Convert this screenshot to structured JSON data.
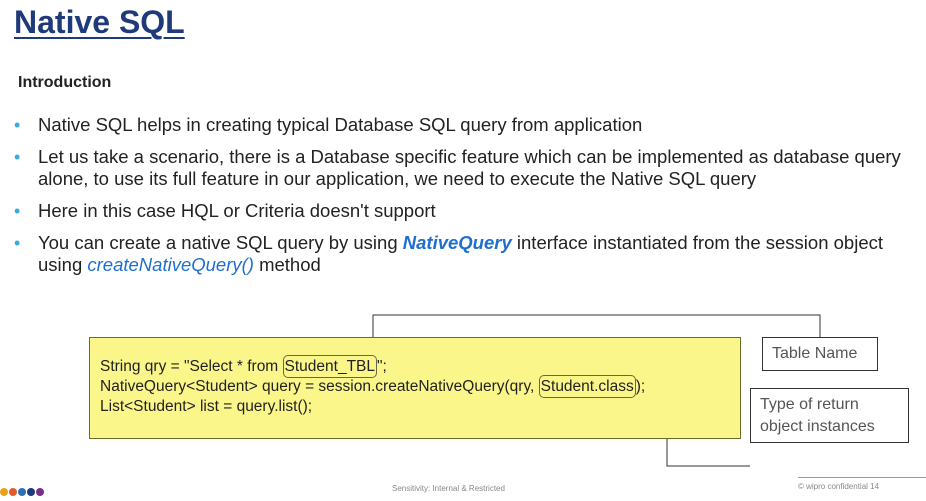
{
  "title": "Native SQL",
  "subtitle": "Introduction",
  "bullets": {
    "b1": "Native SQL helps in creating typical Database SQL query from application",
    "b2": "Let us take a scenario, there is a Database specific feature which can be implemented as database query alone, to use its full feature in our application, we need to execute the Native SQL query",
    "b3": "Here in this case HQL or Criteria doesn't support",
    "b4_pre": "You can create a native SQL query by using ",
    "b4_emph1": "NativeQuery",
    "b4_mid": " interface instantiated from the session object using ",
    "b4_emph2": "createNativeQuery()",
    "b4_post": " method"
  },
  "bullet_glyph": "•",
  "code": {
    "l1_pre": "String qry = \"Select * from ",
    "l1_hl": "Student_TBL",
    "l1_post": "\";",
    "l2_pre": "NativeQuery<Student> query = session.createNativeQuery(qry, ",
    "l2_hl": "Student.class",
    "l2_post": ");",
    "l3": "List<Student> list = query.list();"
  },
  "callouts": {
    "table_name": "Table Name",
    "type_of_return": "Type of return object instances"
  },
  "footer": {
    "center": "Sensitivity: Internal & Restricted",
    "right": "© wipro   confidential   14"
  },
  "colors": {
    "title": "#1f3a7a",
    "bullet": "#3fa9e0",
    "emphasis": "#1f6fd0",
    "codebox": "#fbf68a",
    "footer_dots": [
      "#e8a21a",
      "#e05a2b",
      "#2f6fb7",
      "#1f3a7a",
      "#7b2d8f"
    ]
  }
}
